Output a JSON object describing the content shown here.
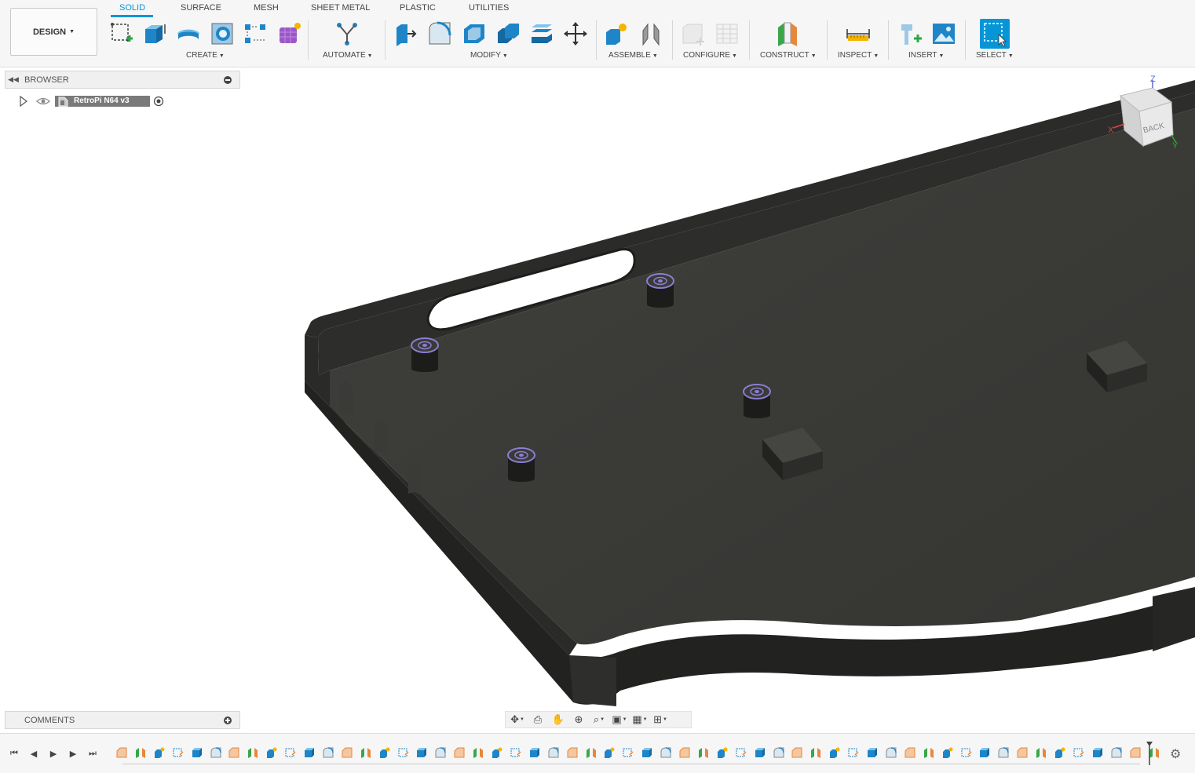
{
  "workspace": {
    "label": "DESIGN"
  },
  "tabs": [
    {
      "label": "SOLID",
      "active": true
    },
    {
      "label": "SURFACE",
      "active": false
    },
    {
      "label": "MESH",
      "active": false
    },
    {
      "label": "SHEET METAL",
      "active": false
    },
    {
      "label": "PLASTIC",
      "active": false
    },
    {
      "label": "UTILITIES",
      "active": false
    }
  ],
  "groups": {
    "create": "CREATE",
    "automate": "AUTOMATE",
    "modify": "MODIFY",
    "assemble": "ASSEMBLE",
    "configure": "CONFIGURE",
    "construct": "CONSTRUCT",
    "inspect": "INSPECT",
    "insert": "INSERT",
    "select": "SELECT"
  },
  "browser": {
    "title": "BROWSER",
    "root_item": "RetroPi N64 v3"
  },
  "comments": {
    "title": "COMMENTS"
  },
  "viewcube": {
    "face_label": "BACK",
    "axis_x": "X",
    "axis_y": "Y",
    "axis_z": "Z"
  },
  "colors": {
    "accent": "#0696d7",
    "body": "#3a3a38",
    "body_dark": "#262624",
    "boss_ring": "#8a7fd0"
  },
  "timeline": {
    "feature_count": 56
  }
}
